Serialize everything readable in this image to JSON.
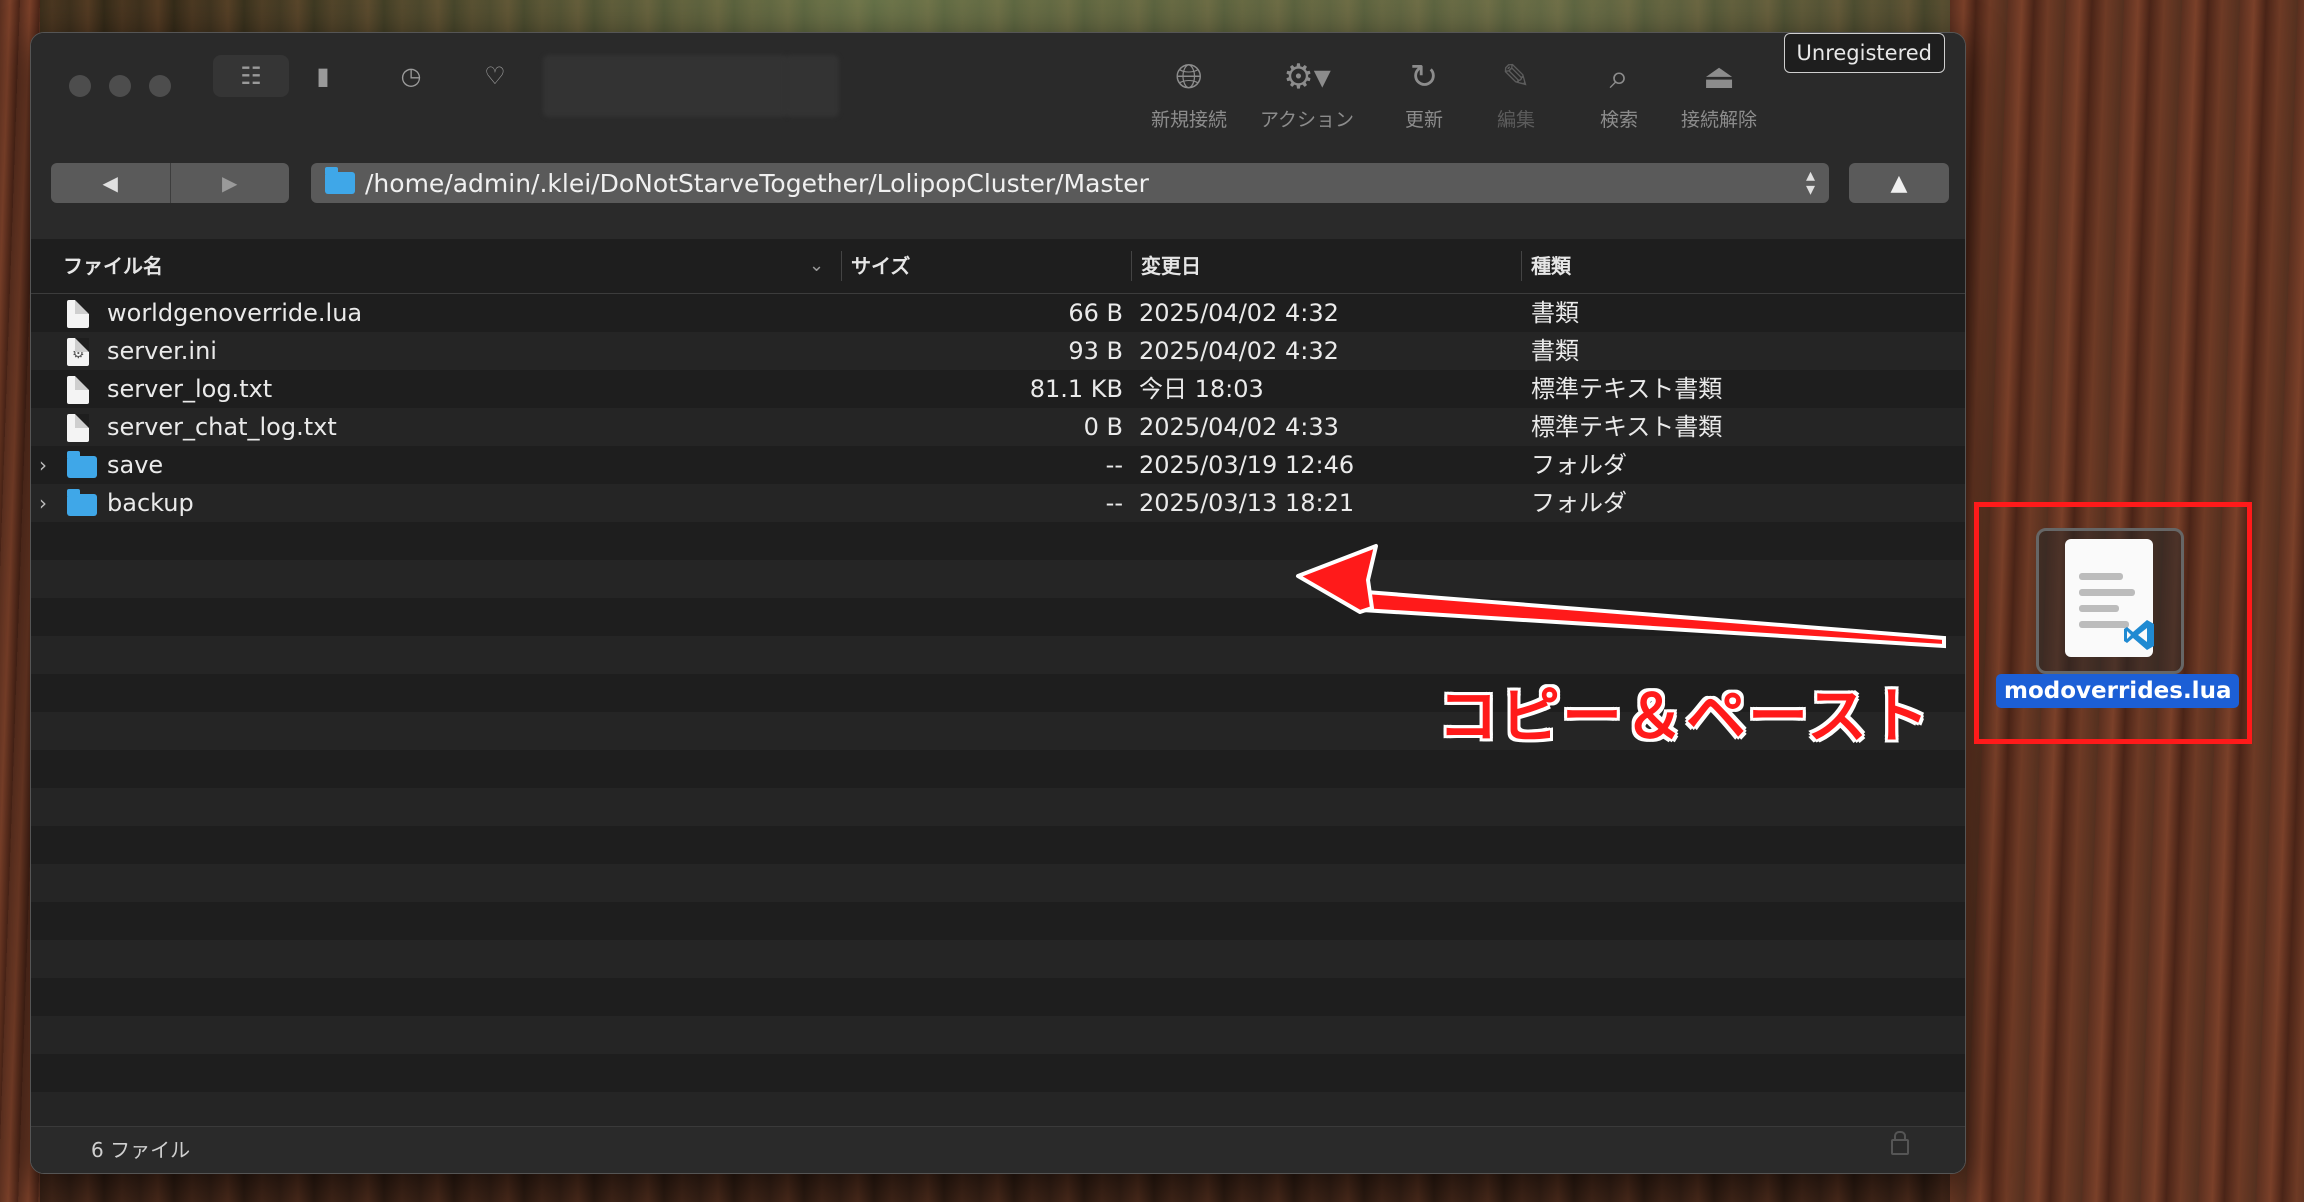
{
  "window": {
    "unregistered_label": "Unregistered",
    "toolbar": [
      {
        "icon": "globe-plus-icon",
        "label": "新規接続",
        "enabled": true
      },
      {
        "icon": "gear-icon",
        "label": "アクション",
        "enabled": true
      },
      {
        "icon": "refresh-icon",
        "label": "更新",
        "enabled": true
      },
      {
        "icon": "pencil-icon",
        "label": "編集",
        "enabled": false
      },
      {
        "icon": "search-icon",
        "label": "検索",
        "enabled": true
      },
      {
        "icon": "eject-icon",
        "label": "接続解除",
        "enabled": true
      }
    ]
  },
  "nav": {
    "back_icon": "◀",
    "forward_icon": "▶",
    "path": "/home/admin/.klei/DoNotStarveTogether/LolipopCluster/Master",
    "up_icon": "▲"
  },
  "columns": {
    "name": "ファイル名",
    "size": "サイズ",
    "modified": "変更日",
    "kind": "種類"
  },
  "files": [
    {
      "name": "worldgenoverride.lua",
      "size": "66 B",
      "modified": "2025/04/02 4:32",
      "kind": "書類",
      "type": "file"
    },
    {
      "name": "server.ini",
      "size": "93 B",
      "modified": "2025/04/02 4:32",
      "kind": "書類",
      "type": "config"
    },
    {
      "name": "server_log.txt",
      "size": "81.1 KB",
      "modified": "今日 18:03",
      "kind": "標準テキスト書類",
      "type": "file"
    },
    {
      "name": "server_chat_log.txt",
      "size": "0 B",
      "modified": "2025/04/02 4:33",
      "kind": "標準テキスト書類",
      "type": "file"
    },
    {
      "name": "save",
      "size": "--",
      "modified": "2025/03/19 12:46",
      "kind": "フォルダ",
      "type": "folder"
    },
    {
      "name": "backup",
      "size": "--",
      "modified": "2025/03/13 18:21",
      "kind": "フォルダ",
      "type": "folder"
    }
  ],
  "status": {
    "text": "6 ファイル"
  },
  "annotation": {
    "label": "コピー＆ペースト",
    "color": "#ff1a1a"
  },
  "desktop_file": {
    "name": "modoverrides.lua"
  }
}
